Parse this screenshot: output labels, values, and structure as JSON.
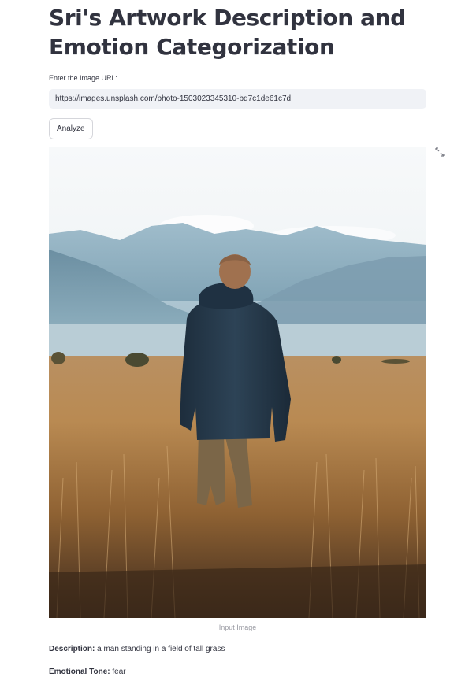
{
  "page": {
    "title": "Sri's Artwork Description and Emotion Categorization"
  },
  "url_input": {
    "label": "Enter the Image URL:",
    "value": "https://images.unsplash.com/photo-1503023345310-bd7c1de61c7d"
  },
  "analyze_button": {
    "label": "Analyze"
  },
  "image": {
    "caption": "Input Image",
    "fullscreen_icon": "expand-icon"
  },
  "results": {
    "description_label": "Description:",
    "description_value": "a man standing in a field of tall grass",
    "tone_label": "Emotional Tone:",
    "tone_value": "fear"
  },
  "colors": {
    "text": "#31333f",
    "input_bg": "#f0f2f6",
    "caption": "#9a9ba3"
  }
}
